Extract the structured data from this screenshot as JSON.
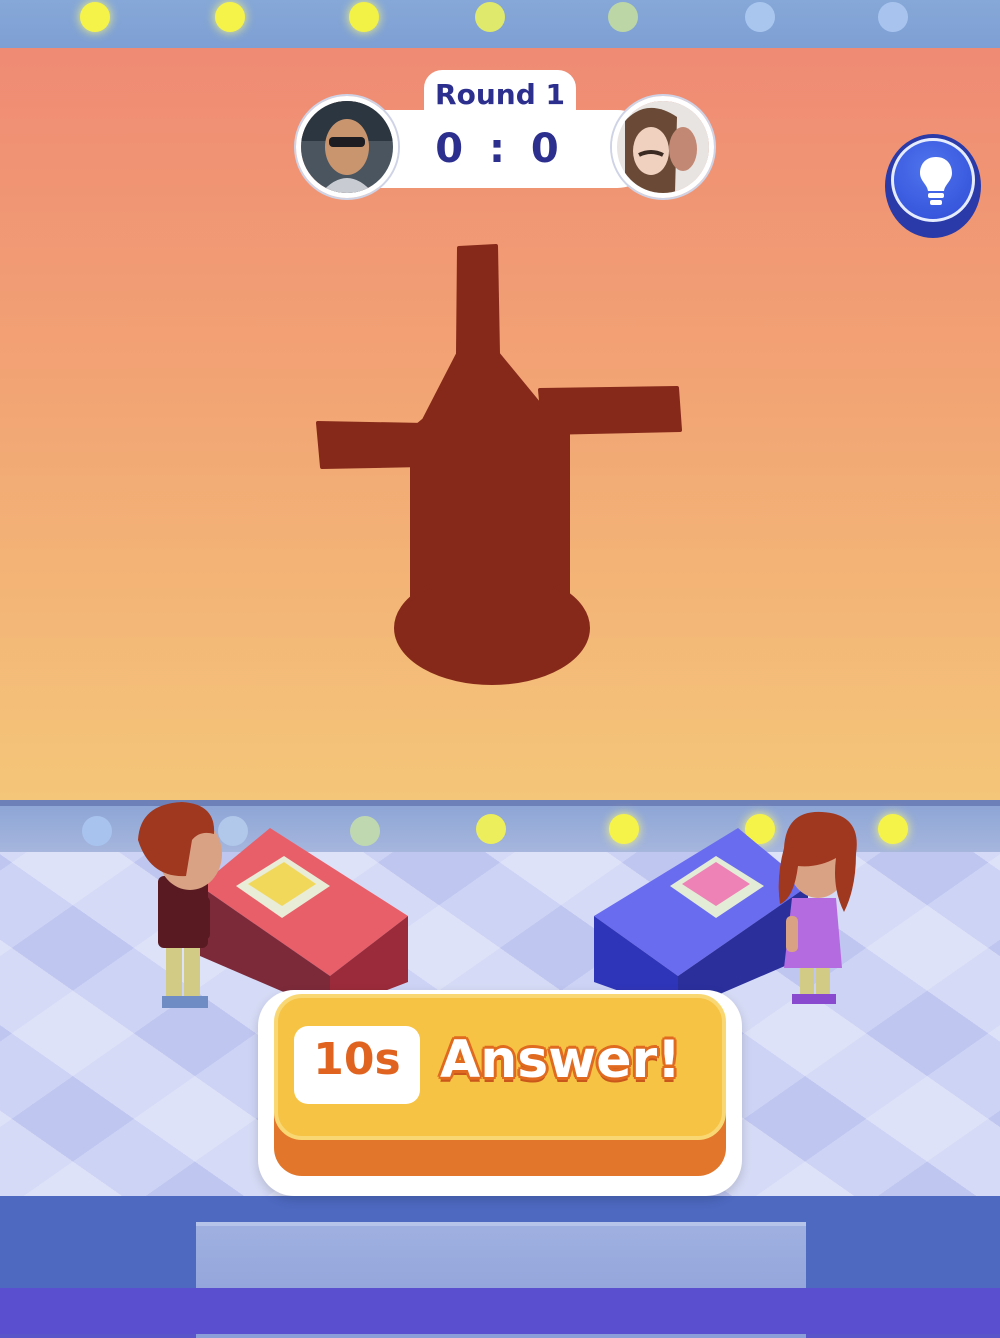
{
  "scoreboard": {
    "round_label": "Round 1",
    "score_text": "0 : 0",
    "player_left_score": 0,
    "player_right_score": 0
  },
  "answer_button": {
    "timer_label": "10s",
    "label": "Answer!"
  },
  "puzzle": {
    "silhouette": "windmill"
  },
  "icons": {
    "hint": "lightbulb-icon"
  },
  "colors": {
    "screen_top": "#ef8a74",
    "screen_bottom": "#f4c679",
    "silhouette": "#86291a",
    "accent_navy": "#2d2f8f",
    "answer_yellow": "#f6c344",
    "answer_orange": "#e2772c",
    "hint_blue": "#2f4cd6",
    "left_desk": "#e85f6a",
    "right_desk": "#5a5be6"
  }
}
